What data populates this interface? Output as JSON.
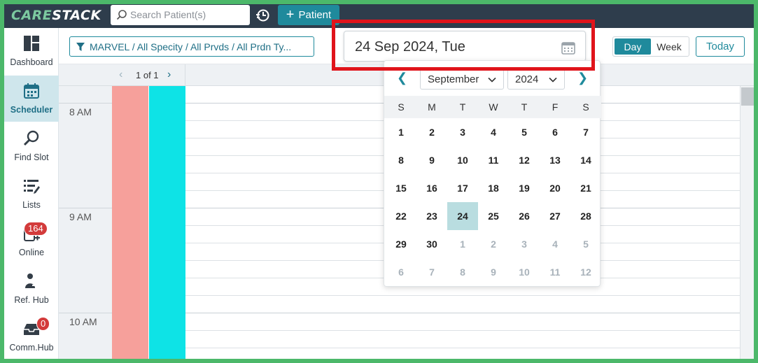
{
  "app": {
    "logo_prefix": "CARE",
    "logo_suffix": "STACK",
    "search_placeholder": "Search Patient(s)",
    "patient_button": "Patient"
  },
  "sidebar": {
    "items": [
      {
        "label": "Dashboard",
        "icon": "dashboard-icon"
      },
      {
        "label": "Scheduler",
        "icon": "calendar-icon",
        "active": true
      },
      {
        "label": "Find Slot",
        "icon": "search-icon"
      },
      {
        "label": "Lists",
        "icon": "list-icon"
      },
      {
        "label": "Online",
        "icon": "online-icon",
        "badge": "164"
      },
      {
        "label": "Ref. Hub",
        "icon": "referral-icon"
      },
      {
        "label": "Comm.Hub",
        "icon": "inbox-icon",
        "badge": "0"
      }
    ]
  },
  "toolbar": {
    "filter_label": "MARVEL / All Specity / All Prvds / All Prdn Ty...",
    "date_value": "24 Sep 2024, Tue",
    "view_day": "Day",
    "view_week": "Week",
    "today": "Today"
  },
  "pager": {
    "label": "1 of 1"
  },
  "times": [
    "8 AM",
    "9 AM",
    "10 AM"
  ],
  "calendar": {
    "month": "September",
    "year": "2024",
    "dow": [
      "S",
      "M",
      "T",
      "W",
      "T",
      "F",
      "S"
    ],
    "weeks": [
      [
        "1",
        "2",
        "3",
        "4",
        "5",
        "6",
        "7"
      ],
      [
        "8",
        "9",
        "10",
        "11",
        "12",
        "13",
        "14"
      ],
      [
        "15",
        "16",
        "17",
        "18",
        "19",
        "20",
        "21"
      ],
      [
        "22",
        "23",
        "24",
        "25",
        "26",
        "27",
        "28"
      ],
      [
        "29",
        "30",
        "1",
        "2",
        "3",
        "4",
        "5"
      ],
      [
        "6",
        "7",
        "8",
        "9",
        "10",
        "11",
        "12"
      ]
    ],
    "selected_day": "24"
  },
  "colors": {
    "topbar": "#2e3d4c",
    "accent": "#1f8a9c",
    "provider1": "#f6a09b",
    "provider2": "#0ee3e6",
    "highlight_outline": "#e0141b",
    "badge": "#d33b3b"
  }
}
